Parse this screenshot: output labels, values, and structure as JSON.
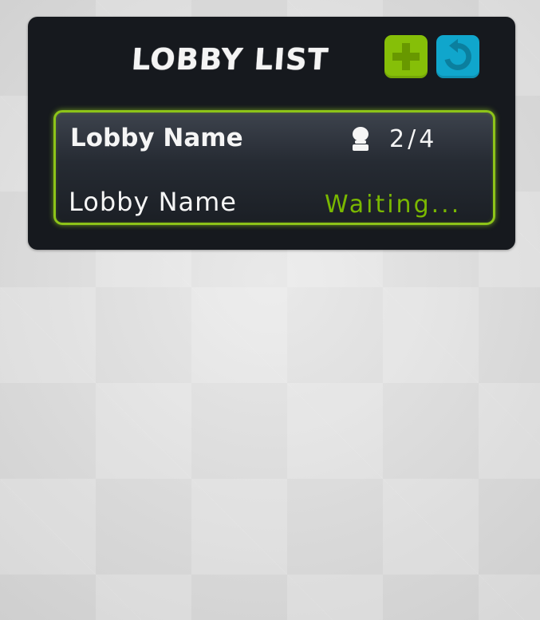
{
  "panel": {
    "title": "LOBBY LIST"
  },
  "buttons": {
    "add_icon": "plus-icon",
    "refresh_icon": "refresh-icon",
    "add_color": "#86bf08",
    "refresh_color": "#10a6cc"
  },
  "lobbies": [
    {
      "name": "Lobby Name",
      "subtitle": "Lobby Name",
      "players": "2/4",
      "player_icon": "player-icon",
      "status": "Waiting...",
      "status_color": "#7ab800",
      "highlight_color": "#8dc419"
    }
  ]
}
